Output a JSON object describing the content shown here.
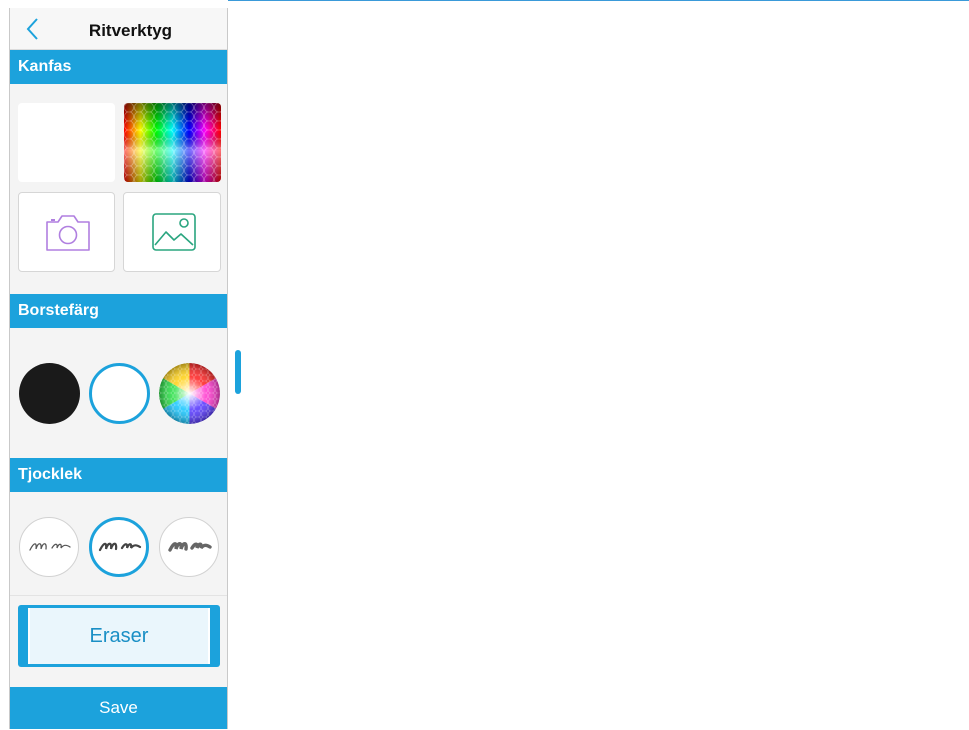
{
  "panel": {
    "title": "Ritverktyg",
    "back_icon": "chevron-left-icon"
  },
  "canvas_section": {
    "heading": "Kanfas",
    "options": [
      {
        "name": "white-canvas"
      },
      {
        "name": "color-palette-canvas"
      },
      {
        "name": "camera",
        "icon": "camera-icon"
      },
      {
        "name": "photo-library",
        "icon": "image-icon"
      }
    ]
  },
  "brush_color_section": {
    "heading": "Borstefärg",
    "swatches": [
      {
        "name": "black",
        "color": "#1a1a1a"
      },
      {
        "name": "white",
        "color": "#ffffff",
        "selected": true
      },
      {
        "name": "color-wheel"
      }
    ]
  },
  "thickness_section": {
    "heading": "Tjocklek",
    "options": [
      {
        "name": "thin"
      },
      {
        "name": "medium",
        "selected": true
      },
      {
        "name": "thick"
      }
    ]
  },
  "eraser": {
    "label": "Eraser"
  },
  "save": {
    "label": "Save"
  },
  "colors": {
    "accent": "#1ca2dc",
    "camera_icon": "#b07fe0",
    "image_icon": "#2aa57f"
  }
}
